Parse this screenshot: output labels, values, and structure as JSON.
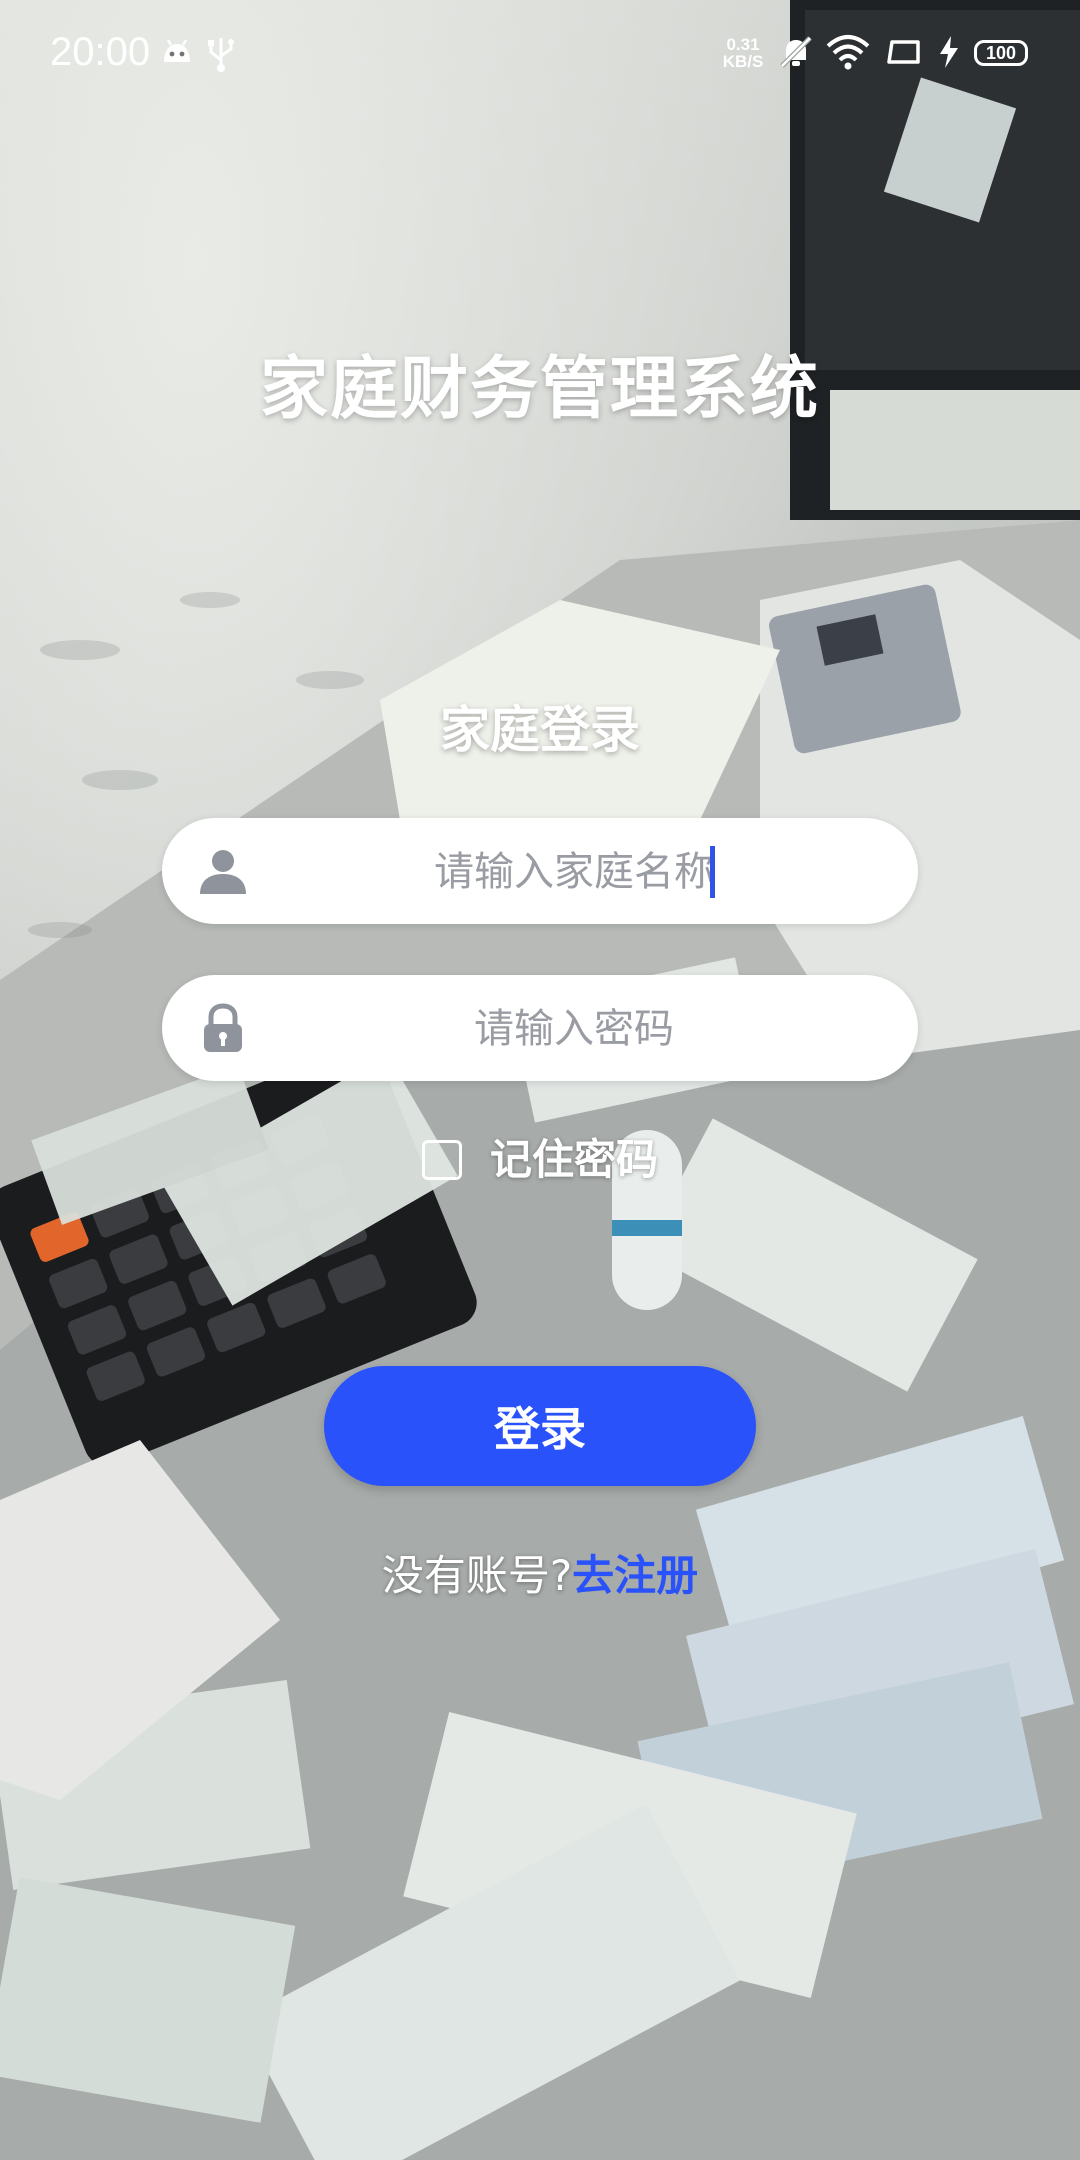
{
  "status_bar": {
    "time": "20:00",
    "net_speed_value": "0.31",
    "net_speed_unit": "KB/S",
    "battery": "100",
    "icons": [
      "android-icon",
      "usb-icon",
      "mute-bell-icon",
      "wifi-icon",
      "screen-rotate-icon",
      "charging-icon",
      "battery-icon"
    ]
  },
  "app": {
    "title": "家庭财务管理系统"
  },
  "login": {
    "section_title": "家庭登录",
    "name_placeholder": "请输入家庭名称",
    "password_placeholder": "请输入密码",
    "remember_label": "记住密码",
    "remember_checked": false,
    "login_button": "登录",
    "register_prompt": "没有账号?",
    "register_link": "去注册"
  },
  "colors": {
    "accent": "#2a52fb",
    "text_on_bg": "#ffffff",
    "input_bg": "#ffffff",
    "placeholder": "#9a9ca3"
  }
}
